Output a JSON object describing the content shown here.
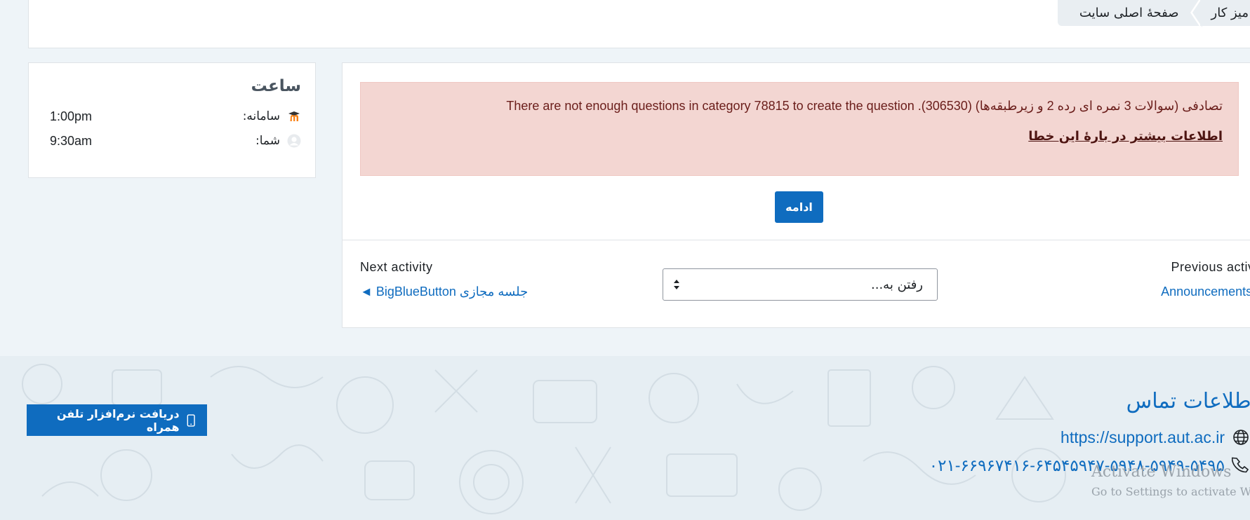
{
  "breadcrumb": {
    "items": [
      "میز کار",
      "صفحهٔ اصلی سایت"
    ]
  },
  "clock": {
    "title": "ساعت",
    "rows": [
      {
        "label": "سامانه:",
        "time": "1:00pm",
        "icon": "moodle-icon"
      },
      {
        "label": "شما:",
        "time": "9:30am",
        "icon": "user-avatar-icon"
      }
    ]
  },
  "alert": {
    "message": "تصادفی (سوالات 3 نمره ای رده 2 و زیرطبقه‌ها) (306530). There are not enough questions in category 78815 to create the question",
    "more_info": "اطلاعات بیشتر در بارهٔ این خطا",
    "color_bg": "#f3d6d2",
    "color_text": "#6a1d1a"
  },
  "continue_label": "ادامه",
  "activity_nav": {
    "previous_label": "Previous activity",
    "previous_link": "Announcements ►",
    "next_label": "Next activity",
    "next_link": "◄ BigBlueButton جلسه مجازی",
    "jump_placeholder": "رفتن به..."
  },
  "footer": {
    "app_button": "دریافت نرم‌افزار تلفن همراه",
    "contact_title": "اطلاعات تماس",
    "website": "https://support.aut.ac.ir",
    "phone": "۰۲۱-۶۶۹۶۷۴۱۶-۶۴۵۴۵۹۴۷-۵۹۴۸-۵۹۴۹-۵۴۹۵",
    "accent": "#0f6cbf"
  },
  "watermark": {
    "line1": "Activate Windows",
    "line2": "Go to Settings to activate Wi"
  }
}
